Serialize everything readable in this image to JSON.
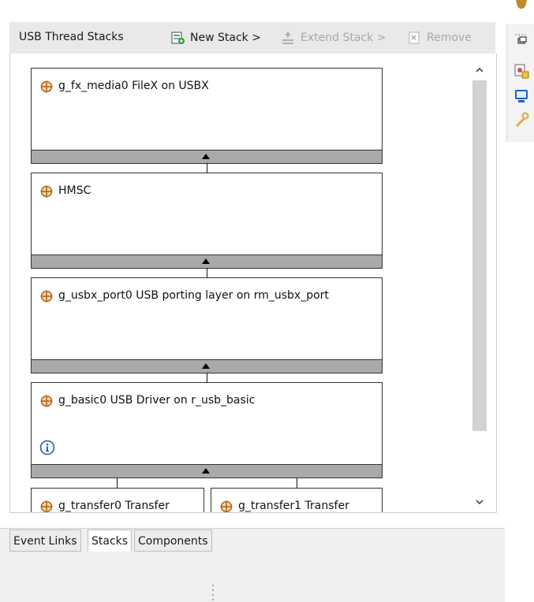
{
  "header": {
    "title": "USB Thread Stacks",
    "new_stack_label": "New Stack >",
    "extend_stack_label": "Extend Stack >",
    "remove_label": "Remove"
  },
  "blocks": [
    {
      "title": "g_fx_media0 FileX on USBX"
    },
    {
      "title": "HMSC"
    },
    {
      "title": "g_usbx_port0 USB porting layer on rm_usbx_port"
    },
    {
      "title": "g_basic0 USB Driver on r_usb_basic"
    }
  ],
  "child_blocks": [
    {
      "title": "g_transfer0 Transfer"
    },
    {
      "title": "g_transfer1 Transfer"
    }
  ],
  "bottom_tabs": [
    {
      "label": "Event Links"
    },
    {
      "label": "Stacks"
    },
    {
      "label": "Components"
    }
  ],
  "colors": {
    "accent_orange": "#b5651d",
    "info_blue": "#1f5fbf",
    "bar_gray": "#a9a9a9"
  }
}
